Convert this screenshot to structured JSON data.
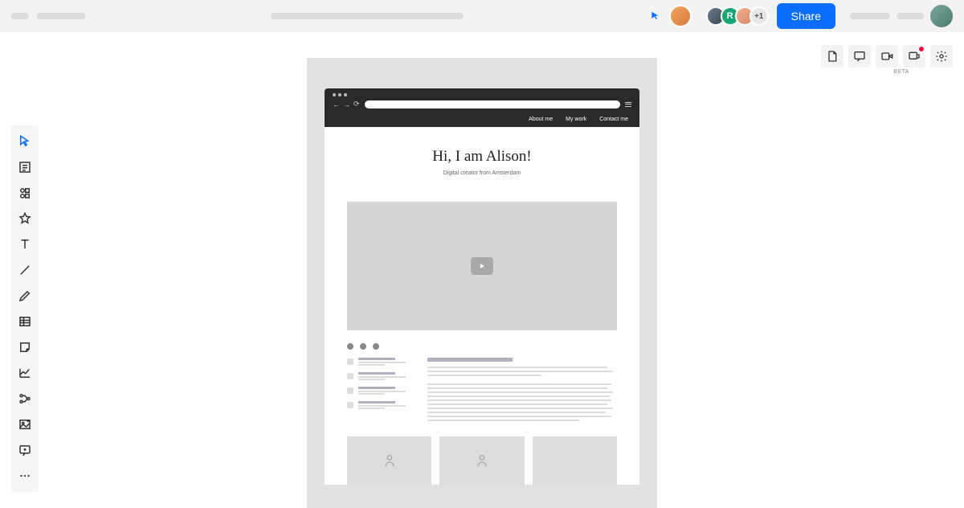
{
  "header": {
    "share_label": "Share",
    "overflow_avatar": "+1",
    "collaborator_initial": "R",
    "beta_label": "BETA"
  },
  "mockup": {
    "nav": [
      "About me",
      "My work",
      "Contact me"
    ],
    "hero_title": "Hi, I am Alison!",
    "hero_subtitle": "Digital creator from Amsterdam"
  }
}
